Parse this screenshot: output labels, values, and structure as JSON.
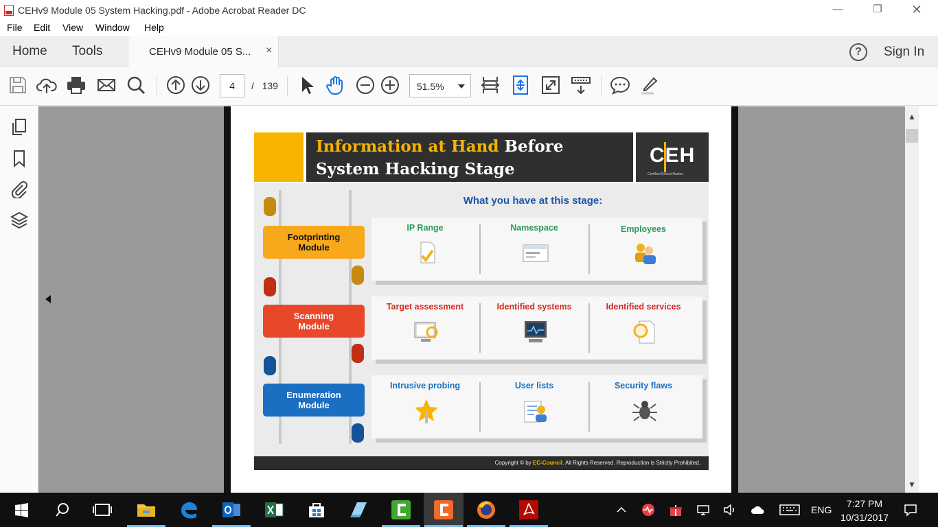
{
  "window": {
    "title": "CEHv9 Module 05 System Hacking.pdf - Adobe Acrobat Reader DC",
    "minimize_icon": "minimize-icon",
    "maximize_icon": "restore-icon",
    "close_icon": "close-icon"
  },
  "menu": {
    "items": [
      "File",
      "Edit",
      "View",
      "Window",
      "Help"
    ]
  },
  "tabs": {
    "home": "Home",
    "tools": "Tools",
    "document": "CEHv9 Module 05 S...",
    "close_symbol": "×",
    "help_symbol": "?",
    "sign_in": "Sign In"
  },
  "toolbar": {
    "current_page": "4",
    "page_separator": "/",
    "total_pages": "139",
    "zoom": "51.5%"
  },
  "slide": {
    "title_highlight": "Information at Hand",
    "title_rest": "Before",
    "title_line2": "System Hacking Stage",
    "logo_text": "CEH",
    "logo_subtext": "Certified   Ethical   Hacker",
    "subtitle": "What you have at this stage:",
    "modules": [
      {
        "line1": "Footprinting",
        "line2": "Module",
        "color": "#f7a81b"
      },
      {
        "line1": "Scanning",
        "line2": "Module",
        "color": "#e8472a"
      },
      {
        "line1": "Enumeration",
        "line2": "Module",
        "color": "#1a6fc2"
      }
    ],
    "rows": [
      {
        "color": "#2a9a5b",
        "items": [
          "IP Range",
          "Namespace",
          "Employees"
        ]
      },
      {
        "color": "#d42a20",
        "items": [
          "Target assessment",
          "Identified systems",
          "Identified services"
        ]
      },
      {
        "color": "#1b6fbf",
        "items": [
          "Intrusive probing",
          "User lists",
          "Security flaws"
        ]
      }
    ],
    "copyright_pre": "Copyright © by",
    "copyright_brand": "EC-Council",
    "copyright_post": ". All Rights Reserved. Reproduction is Strictly Prohibited."
  },
  "taskbar": {
    "language": "ENG",
    "time": "7:27 PM",
    "date": "10/31/2017"
  }
}
